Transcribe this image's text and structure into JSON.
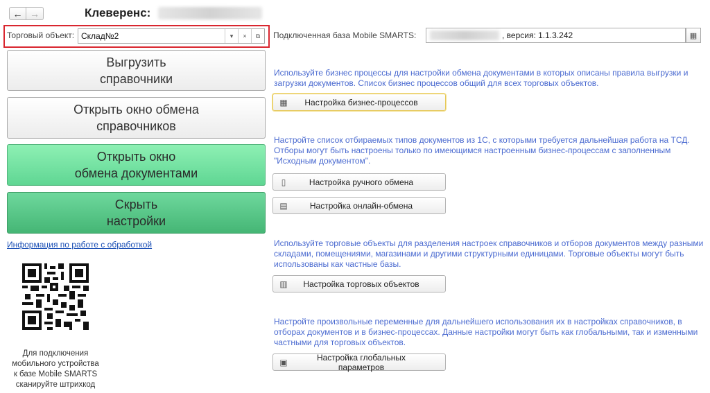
{
  "header": {
    "back_glyph": "←",
    "forward_glyph": "→",
    "title": "Клеверенс:"
  },
  "trade_object": {
    "label": "Торговый объект:",
    "value": "Склад№2",
    "dropdown_glyph": "▾",
    "clear_glyph": "×",
    "open_glyph": "⧉"
  },
  "left_buttons": {
    "export": [
      "Выгрузить",
      "справочники"
    ],
    "open_catalog_exchange": [
      "Открыть окно обмена",
      "справочников"
    ],
    "open_doc_exchange": [
      "Открыть окно",
      "обмена документами"
    ],
    "hide_settings": [
      "Скрыть",
      "настройки"
    ]
  },
  "info_link": "Информация по работе с обработкой",
  "qr_caption": [
    "Для подключения",
    "мобильного устройства",
    "к базе Mobile SMARTS",
    "сканируйте штрихкод"
  ],
  "database": {
    "label": "Подключенная база Mobile SMARTS:",
    "version_text": ", версия: 1.1.3.242"
  },
  "sections": [
    {
      "description": "Используйте бизнес процессы для настройки обмена документами в которых описаны правила выгрузки и загрузки документов. Список бизнес процессов общий для всех торговых объектов.",
      "buttons": [
        {
          "label": "Настройка бизнес-процессов",
          "icon": "table-icon",
          "glyph": "▦"
        }
      ]
    },
    {
      "description": "Настройте список отбираемых типов документов из 1С, с которыми требуется дальнейшая работа на ТСД. Отборы могут быть настроены только по имеющимся настроенным бизнес-процессам с заполненным \"Исходным документом\".",
      "buttons": [
        {
          "label": "Настройка ручного обмена",
          "icon": "document-icon",
          "glyph": "▯"
        },
        {
          "label": "Настройка онлайн-обмена",
          "icon": "online-doc-icon",
          "glyph": "▤"
        }
      ]
    },
    {
      "description": "Используйте торговые объекты для разделения настроек справочников и отборов документов между разными складами, помещениями, магазинами и другими структурными единицами. Торговые объекты могут быть использованы как частные базы.",
      "buttons": [
        {
          "label": "Настройка торговых объектов",
          "icon": "list-icon",
          "glyph": "▥"
        }
      ]
    },
    {
      "description": "Настройте произвольные переменные для дальнейшего использования их в настройках справочников, в отборах документов и в бизнес-процессах. Данные настройки могут быть как глобальными, так и изменными частными для торговых объектов.",
      "buttons": [
        {
          "label": "Настройка глобальных параметров",
          "icon": "params-icon",
          "glyph": "▣"
        }
      ]
    }
  ],
  "colors": {
    "accent_link": "#1a4fb5",
    "description_text": "#4a6ad0",
    "highlight_border": "#d9262f",
    "green_button": "#5fd693",
    "green_button_dark": "#45b675"
  }
}
